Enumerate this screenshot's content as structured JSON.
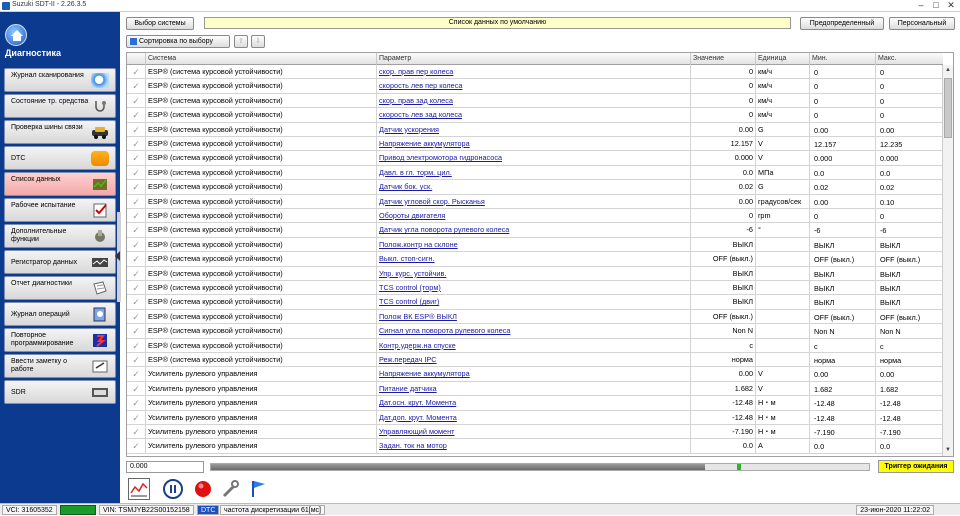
{
  "window": {
    "title": "Suzuki SDT-II - 2.26.3.5",
    "min": "–",
    "max": "□",
    "close": "✕"
  },
  "sidebar": {
    "heading": "Диагностика",
    "items": [
      {
        "label": "Журнал сканирования",
        "icon": "magnifier-icon"
      },
      {
        "label": "Состояние тр. средства",
        "icon": "stethoscope-icon"
      },
      {
        "label": "Проверка шины связи",
        "icon": "car-bus-icon"
      },
      {
        "label": "DTC",
        "icon": "dtc-icon"
      },
      {
        "label": "Список данных",
        "icon": "data-list-icon"
      },
      {
        "label": "Рабочее испытание",
        "icon": "checklist-icon"
      },
      {
        "label": "Дополнительные функции",
        "icon": "tools-icon"
      },
      {
        "label": "Регистратор данных",
        "icon": "recorder-icon"
      },
      {
        "label": "Отчет диагностики",
        "icon": "report-icon"
      },
      {
        "label": "Журнал операций",
        "icon": "log-icon"
      },
      {
        "label": "Повторное программирование",
        "icon": "reprogram-icon"
      },
      {
        "label": "Ввести заметку о работе",
        "icon": "note-icon"
      },
      {
        "label": "SDR",
        "icon": "sdr-icon"
      }
    ]
  },
  "toolbar": {
    "system_select": "Выбор системы",
    "banner": "Список данных по умолчанию",
    "predefined": "Предопределенный",
    "personal": "Персональный",
    "sort": "Сортировка по выбору"
  },
  "table": {
    "headers": [
      "Система",
      "Параметр",
      "Значение",
      "Единица",
      "Мин.",
      "Макс."
    ],
    "rows": [
      [
        "ESP® (система курсовой устойчивости)",
        "скор. прав пер колеса",
        "0",
        "км/ч",
        "0",
        "0"
      ],
      [
        "ESP® (система курсовой устойчивости)",
        "скорость лев пер колеса",
        "0",
        "км/ч",
        "0",
        "0"
      ],
      [
        "ESP® (система курсовой устойчивости)",
        "скор. прав зад колеса",
        "0",
        "км/ч",
        "0",
        "0"
      ],
      [
        "ESP® (система курсовой устойчивости)",
        "скорость лев зад колеса",
        "0",
        "км/ч",
        "0",
        "0"
      ],
      [
        "ESP® (система курсовой устойчивости)",
        "Датчик ускорения",
        "0.00",
        "G",
        "0.00",
        "0.00"
      ],
      [
        "ESP® (система курсовой устойчивости)",
        "Напряжение аккумулятора",
        "12.157",
        "V",
        "12.157",
        "12.235"
      ],
      [
        "ESP® (система курсовой устойчивости)",
        "Привод электромотора гидронасоса",
        "0.000",
        "V",
        "0.000",
        "0.000"
      ],
      [
        "ESP® (система курсовой устойчивости)",
        "Давл. в гл. торм. цил.",
        "0.0",
        "МПа",
        "0.0",
        "0.0"
      ],
      [
        "ESP® (система курсовой устойчивости)",
        "Датчик бок. уск.",
        "0.02",
        "G",
        "0.02",
        "0.02"
      ],
      [
        "ESP® (система курсовой устойчивости)",
        "Датчик угловой скор. Рысканья",
        "0.00",
        "градусов/сек",
        "0.00",
        "0.10"
      ],
      [
        "ESP® (система курсовой устойчивости)",
        "Обороты двигателя",
        "0",
        "rpm",
        "0",
        "0"
      ],
      [
        "ESP® (система курсовой устойчивости)",
        "Датчик угла поворота рулевого колеса",
        "-6",
        "°",
        "-6",
        "-6"
      ],
      [
        "ESP® (система курсовой устойчивости)",
        "Полож.контр на склоне",
        "ВЫКЛ",
        "",
        "ВЫКЛ",
        "ВЫКЛ"
      ],
      [
        "ESP® (система курсовой устойчивости)",
        "Выкл. стоп-сигн.",
        "OFF (выкл.)",
        "",
        "OFF (выкл.)",
        "OFF (выкл.)"
      ],
      [
        "ESP® (система курсовой устойчивости)",
        "Упр. курс. устойчив.",
        "ВЫКЛ",
        "",
        "ВЫКЛ",
        "ВЫКЛ"
      ],
      [
        "ESP® (система курсовой устойчивости)",
        "TCS control (торм)",
        "ВЫКЛ",
        "",
        "ВЫКЛ",
        "ВЫКЛ"
      ],
      [
        "ESP® (система курсовой устойчивости)",
        "TCS control (двиг)",
        "ВЫКЛ",
        "",
        "ВЫКЛ",
        "ВЫКЛ"
      ],
      [
        "ESP® (система курсовой устойчивости)",
        "Полож ВК ESP® ВЫКЛ",
        "OFF (выкл.)",
        "",
        "OFF (выкл.)",
        "OFF (выкл.)"
      ],
      [
        "ESP® (система курсовой устойчивости)",
        "Сигнал угла поворота рулевого колеса",
        "Non N",
        "",
        "Non N",
        "Non N"
      ],
      [
        "ESP® (система курсовой устойчивости)",
        "Контр.удерж.на спуске",
        "c",
        "",
        "c",
        "c"
      ],
      [
        "ESP® (система курсовой устойчивости)",
        "Реж.передач IPC",
        "норма",
        "",
        "норма",
        "норма"
      ],
      [
        "Усилитель рулевого управления",
        "Напряжение аккумулятора",
        "0.00",
        "V",
        "0.00",
        "0.00"
      ],
      [
        "Усилитель рулевого управления",
        "Питание датчика",
        "1.682",
        "V",
        "1.682",
        "1.682"
      ],
      [
        "Усилитель рулевого управления",
        "Дат.осн. крут. Момента",
        "-12.48",
        "Н・м",
        "-12.48",
        "-12.48"
      ],
      [
        "Усилитель рулевого управления",
        "Дат.доп. крут. Момента",
        "-12.48",
        "Н・м",
        "-12.48",
        "-12.48"
      ],
      [
        "Усилитель рулевого управления",
        "Управляющий момент",
        "-7.190",
        "Н・м",
        "-7.190",
        "-7.190"
      ],
      [
        "Усилитель рулевого управления",
        "Задан. ток на мотор",
        "0.0",
        "A",
        "0.0",
        "0.0"
      ]
    ]
  },
  "status": {
    "value": "0.000",
    "progress": 0.75,
    "trigger": "Триггер ожидания"
  },
  "bottom": {
    "vci": "VCI: 31605352",
    "vin": "VIN: TSMJYB22S00152158",
    "dtc": "DTC",
    "rate": "частота дискретизации 61[мс]",
    "datetime": "23-июн-2020 11:22:02"
  },
  "colors": {
    "sidebar": "#0b3a8e",
    "link": "#1a1aa8",
    "trigger": "#ffff00",
    "banner": "#ffffc8"
  }
}
